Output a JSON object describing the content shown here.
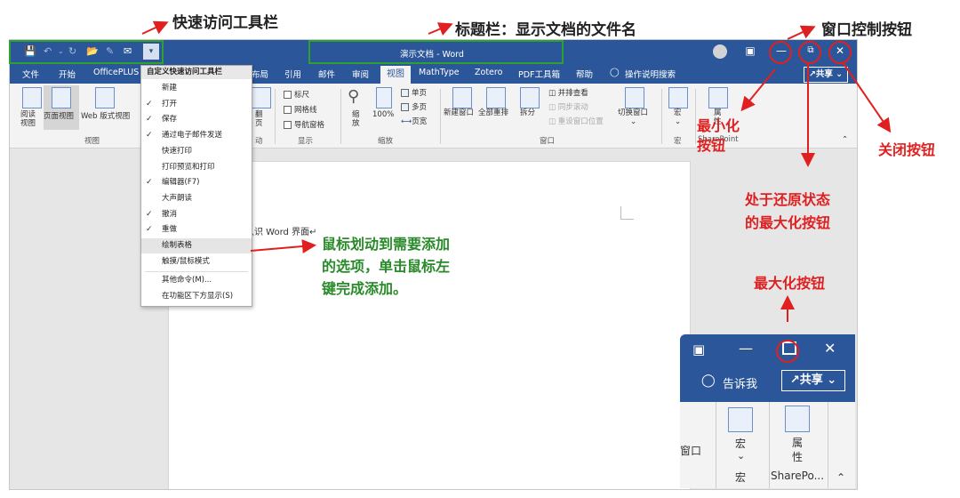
{
  "window": {
    "title": "演示文档 - Word",
    "share_label": "共享",
    "search_label": "操作说明搜索"
  },
  "tabs": [
    "文件",
    "开始",
    "OfficePLUS",
    "布局",
    "引用",
    "邮件",
    "审阅",
    "视图",
    "MathType",
    "Zotero",
    "PDF工具箱",
    "帮助"
  ],
  "active_tab": "视图",
  "ribbon": {
    "read_view": "阅读\n视图",
    "page_view": "页面视图",
    "web_view": "Web 版式视图",
    "views_group": "视图",
    "flip_label": "翻\n页",
    "move_group": "动",
    "show": {
      "ruler": "标尺",
      "gridlines": "网格线",
      "nav_pane": "导航窗格",
      "group": "显示"
    },
    "zoom": {
      "zoom": "缩\n放",
      "percent": "100%",
      "one_page": "单页",
      "multi_page": "多页",
      "page_width": "页宽",
      "group": "缩放"
    },
    "window_group": {
      "new_window": "新建窗口",
      "arrange_all": "全部重排",
      "split": "拆分",
      "side_by_side": "并排查看",
      "sync_scroll": "同步滚动",
      "reset_pos": "重设窗口位置",
      "switch": "切换窗口",
      "group": "窗口"
    },
    "macro": {
      "label": "宏",
      "group": "宏"
    },
    "sharepoint": {
      "label": "属\n性",
      "group": "SharePoint"
    }
  },
  "qat_menu": {
    "title": "自定义快速访问工具栏",
    "items": [
      {
        "label": "新建",
        "checked": false
      },
      {
        "label": "打开",
        "checked": true
      },
      {
        "label": "保存",
        "checked": true
      },
      {
        "label": "通过电子邮件发送",
        "checked": true
      },
      {
        "label": "快速打印",
        "checked": false
      },
      {
        "label": "打印预览和打印",
        "checked": false
      },
      {
        "label": "编辑器(F7)",
        "checked": true
      },
      {
        "label": "大声朗读",
        "checked": false
      },
      {
        "label": "撤消",
        "checked": true
      },
      {
        "label": "重做",
        "checked": true
      },
      {
        "label": "绘制表格",
        "checked": false
      },
      {
        "label": "触摸/鼠标模式",
        "checked": false
      }
    ],
    "more_commands": "其他命令(M)...",
    "show_below": "在功能区下方显示(S)"
  },
  "document": {
    "text": "认识 Word 界面↵"
  },
  "inset": {
    "tell_me": "告诉我",
    "share_label": "共享",
    "window_part": "窗口",
    "macro_label": "宏",
    "macro_group": "宏",
    "props_label": "属\n性",
    "sharepoint_group": "SharePo..."
  },
  "annotations": {
    "qat": "快速访问工具栏",
    "titlebar": "标题栏：显示文档的文件名",
    "window_controls": "窗口控制按钮",
    "minimize": "最小化\n按钮",
    "close": "关闭按钮",
    "restore": "处于还原状态\n的最大化按钮",
    "maximize": "最大化按钮",
    "instruction": "鼠标划动到需要添加\n的选项，单击鼠标左\n键完成添加。"
  },
  "colors": {
    "word_blue": "#2b579a",
    "annotation_red": "#e02020",
    "annotation_green": "#2a8a2a"
  }
}
